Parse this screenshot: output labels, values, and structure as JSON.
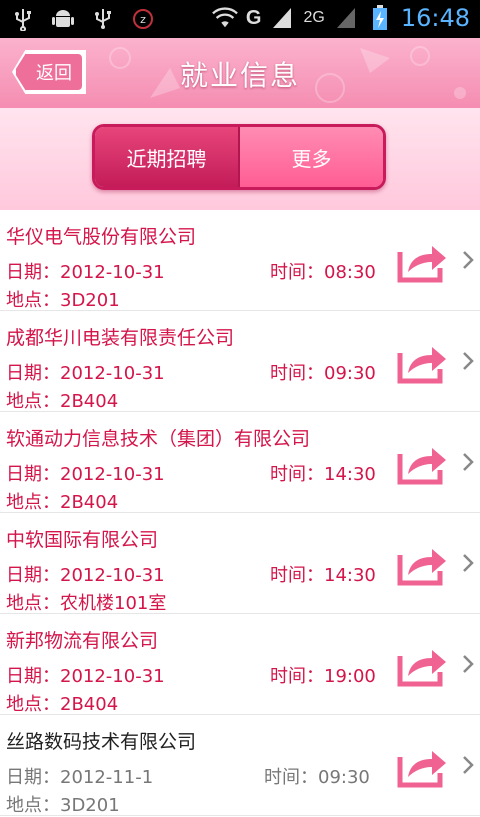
{
  "status_bar": {
    "time": "16:48",
    "network": "G",
    "second_sim": "2G",
    "icons": [
      "usb-icon",
      "android-icon",
      "usb-icon",
      "alarm-icon",
      "wifi-icon",
      "signal-icon",
      "battery-charging-icon"
    ]
  },
  "header": {
    "back_label": "返回",
    "title": "就业信息"
  },
  "tabs": {
    "recent_label": "近期招聘",
    "more_label": "更多",
    "active": "recent"
  },
  "colors": {
    "accent": "#d4154a",
    "title_bg": "#f58db1",
    "tab_active": "#c31c58",
    "tab_inactive": "#ff5d93"
  },
  "jobs": [
    {
      "company": "华仪电气股份有限公司",
      "date": "日期：2012-10-31",
      "time": "时间：08:30",
      "place": "地点：3D201"
    },
    {
      "company": "成都华川电装有限责任公司",
      "date": "日期：2012-10-31",
      "time": "时间：09:30",
      "place": "地点：2B404"
    },
    {
      "company": "软通动力信息技术（集团）有限公司",
      "date": "日期：2012-10-31",
      "time": "时间：14:30",
      "place": "地点：2B404"
    },
    {
      "company": "中软国际有限公司",
      "date": "日期：2012-10-31",
      "time": "时间：14:30",
      "place": "地点：农机楼101室"
    },
    {
      "company": "新邦物流有限公司",
      "date": "日期：2012-10-31",
      "time": "时间：19:00",
      "place": "地点：2B404"
    },
    {
      "company": "丝路数码技术有限公司",
      "date": "日期：2012-11-1",
      "time": "时间：09:30",
      "place": "地点：3D201"
    }
  ]
}
